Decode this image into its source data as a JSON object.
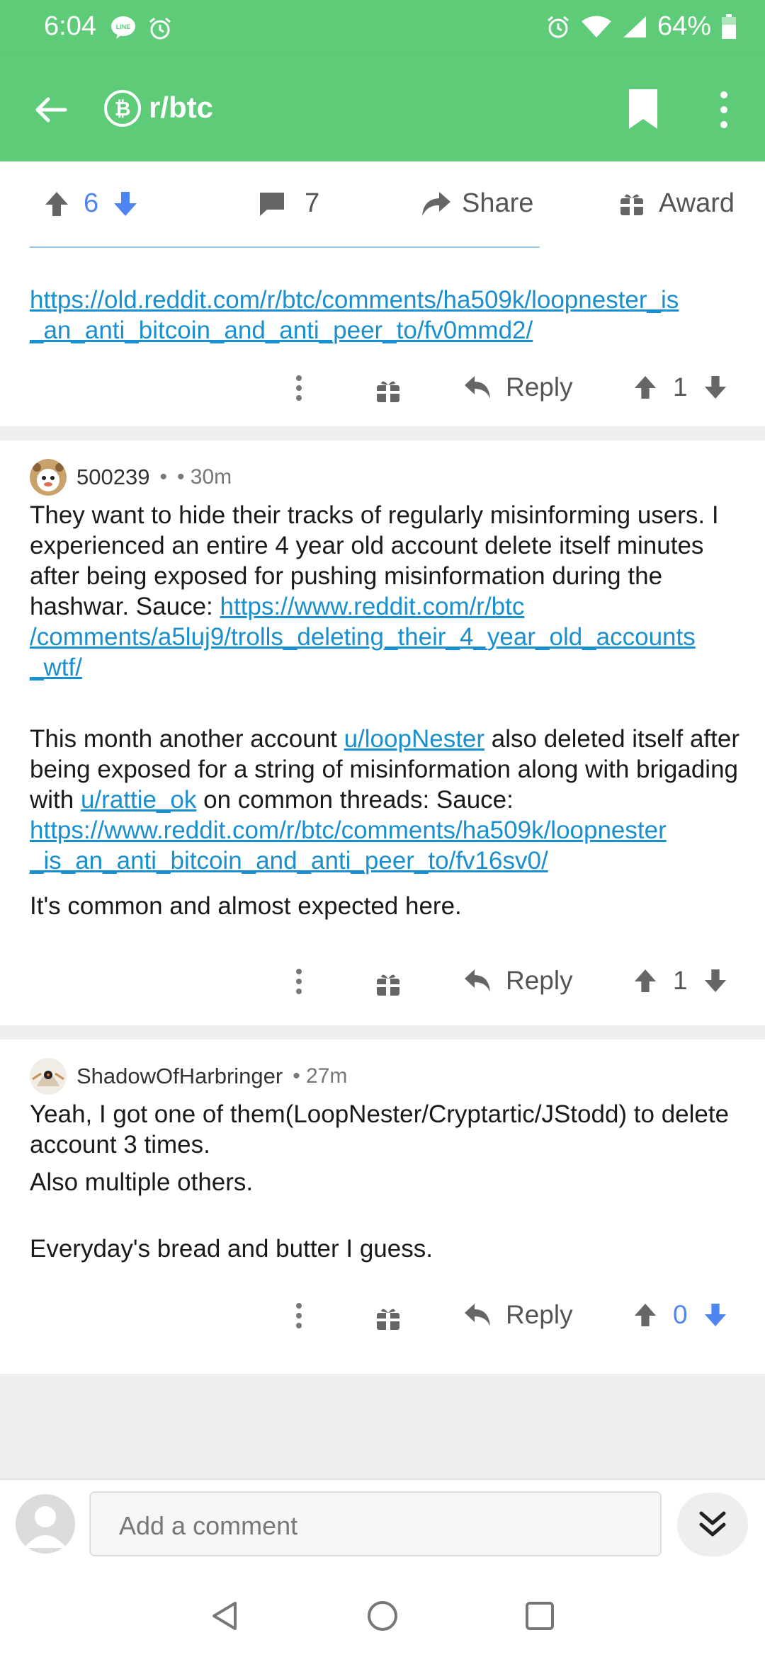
{
  "status_bar": {
    "time": "6:04",
    "battery": "64%"
  },
  "app_bar": {
    "title": "r/btc"
  },
  "post_actions": {
    "upvotes": "6",
    "comments": "7",
    "share": "Share",
    "award": "Award"
  },
  "comments": [
    {
      "link": "https://old.reddit.com/r/btc/comments/ha509k/loopnester_is_an_anti_bitcoin_and_anti_peer_to/fv0mmd2/",
      "link_lines": [
        "https://old.reddit.com/r/btc/comments/ha509k/loopnester_is",
        "_an_anti_bitcoin_and_anti_peer_to/fv0mmd2/"
      ],
      "reply": "Reply",
      "score": "1"
    },
    {
      "author": "500239",
      "dot": "•",
      "time": "• 30m",
      "p1_text": "They want to hide their tracks of regularly misinforming users. I experienced an entire 4 year old account delete itself minutes after being exposed for pushing misinformation during the hashwar. Sauce: ",
      "p1_link_lines": [
        "https://www.reddit.com/r/btc",
        "/comments/a5luj9/trolls_deleting_their_4_year_old_accounts",
        "_wtf/"
      ],
      "p2_a": "This month another account ",
      "p2_link1": "u/loopNester",
      "p2_b": " also deleted itself after being exposed for a string of misinformation along with brigading with ",
      "p2_link2": "u/rattie_ok",
      "p2_c": " on common threads: Sauce: ",
      "p2_link3_lines": [
        "https://www.reddit.com/r/btc/comments/ha509k/loopnester",
        "_is_an_anti_bitcoin_and_anti_peer_to/fv16sv0/"
      ],
      "p3": "It's common and almost expected here.",
      "reply": "Reply",
      "score": "1"
    },
    {
      "author": "ShadowOfHarbringer",
      "time": "• 27m",
      "p1": "Yeah, I got one of them(LoopNester/Cryptartic/JStodd) to delete account 3 times.",
      "p2": "Also multiple others.",
      "p3": "Everyday's bread and butter I guess.",
      "reply": "Reply",
      "score": "0"
    }
  ],
  "comment_box": {
    "placeholder": "Add a comment"
  },
  "icons": [
    "back-arrow-icon",
    "bitcoin-icon",
    "bookmark-icon",
    "more-vert-icon",
    "upvote-icon",
    "downvote-icon",
    "comment-icon",
    "share-icon",
    "gift-icon",
    "reply-icon",
    "expand-icon",
    "nav-back-icon",
    "nav-home-icon",
    "nav-recents-icon"
  ],
  "colors": {
    "brand_green": "#5ecb79",
    "vote_blue": "#4f84f3",
    "link_blue": "#1a8fd0",
    "separator": "#eeeff1"
  }
}
